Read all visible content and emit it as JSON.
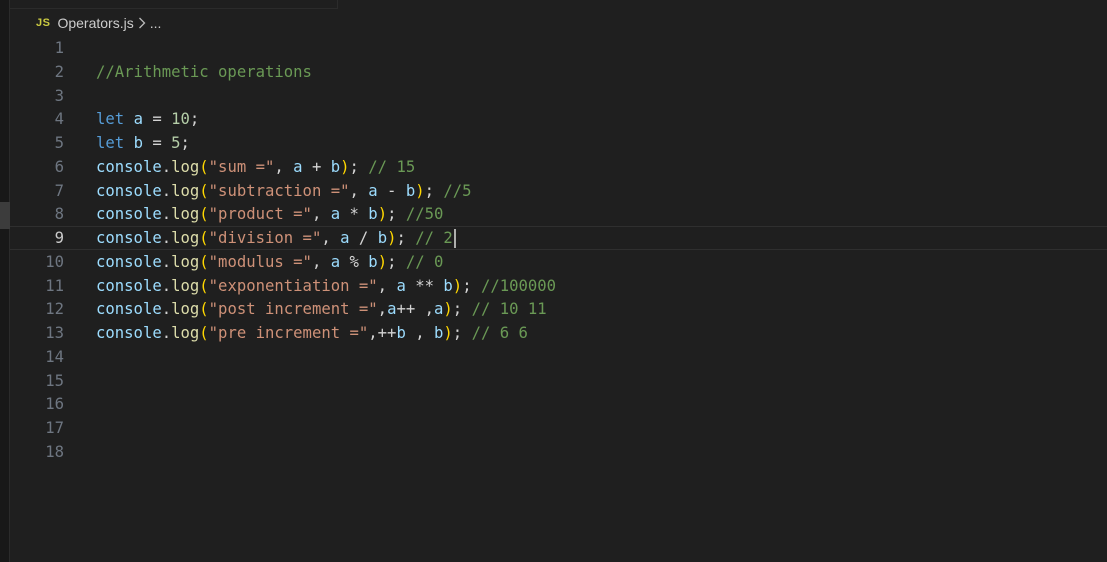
{
  "tab": {
    "filename": "Operators.js",
    "icon_text": "JS",
    "breadcrumb_more": "..."
  },
  "editor": {
    "current_line": 9,
    "lines": [
      {
        "n": "1",
        "tokens": []
      },
      {
        "n": "2",
        "tokens": [
          {
            "t": "//Arithmetic operations",
            "c": "cm"
          }
        ]
      },
      {
        "n": "3",
        "tokens": []
      },
      {
        "n": "4",
        "tokens": [
          {
            "t": "let",
            "c": "kw"
          },
          {
            "t": " ",
            "c": "pl"
          },
          {
            "t": "a",
            "c": "var"
          },
          {
            "t": " = ",
            "c": "op"
          },
          {
            "t": "10",
            "c": "num"
          },
          {
            "t": ";",
            "c": "pl"
          }
        ]
      },
      {
        "n": "5",
        "tokens": [
          {
            "t": "let",
            "c": "kw"
          },
          {
            "t": " ",
            "c": "pl"
          },
          {
            "t": "b",
            "c": "var"
          },
          {
            "t": " = ",
            "c": "op"
          },
          {
            "t": "5",
            "c": "num"
          },
          {
            "t": ";",
            "c": "pl"
          }
        ]
      },
      {
        "n": "6",
        "tokens": [
          {
            "t": "console",
            "c": "obj"
          },
          {
            "t": ".",
            "c": "pl"
          },
          {
            "t": "log",
            "c": "fn"
          },
          {
            "t": "(",
            "c": "paren"
          },
          {
            "t": "\"sum =\"",
            "c": "str"
          },
          {
            "t": ", ",
            "c": "pl"
          },
          {
            "t": "a",
            "c": "var"
          },
          {
            "t": " + ",
            "c": "op"
          },
          {
            "t": "b",
            "c": "var"
          },
          {
            "t": ")",
            "c": "paren"
          },
          {
            "t": "; ",
            "c": "pl"
          },
          {
            "t": "// 15",
            "c": "cm"
          }
        ]
      },
      {
        "n": "7",
        "tokens": [
          {
            "t": "console",
            "c": "obj"
          },
          {
            "t": ".",
            "c": "pl"
          },
          {
            "t": "log",
            "c": "fn"
          },
          {
            "t": "(",
            "c": "paren"
          },
          {
            "t": "\"subtraction =\"",
            "c": "str"
          },
          {
            "t": ", ",
            "c": "pl"
          },
          {
            "t": "a",
            "c": "var"
          },
          {
            "t": " - ",
            "c": "op"
          },
          {
            "t": "b",
            "c": "var"
          },
          {
            "t": ")",
            "c": "paren"
          },
          {
            "t": "; ",
            "c": "pl"
          },
          {
            "t": "//5",
            "c": "cm"
          }
        ]
      },
      {
        "n": "8",
        "tokens": [
          {
            "t": "console",
            "c": "obj"
          },
          {
            "t": ".",
            "c": "pl"
          },
          {
            "t": "log",
            "c": "fn"
          },
          {
            "t": "(",
            "c": "paren"
          },
          {
            "t": "\"product =\"",
            "c": "str"
          },
          {
            "t": ", ",
            "c": "pl"
          },
          {
            "t": "a",
            "c": "var"
          },
          {
            "t": " * ",
            "c": "op"
          },
          {
            "t": "b",
            "c": "var"
          },
          {
            "t": ")",
            "c": "paren"
          },
          {
            "t": "; ",
            "c": "pl"
          },
          {
            "t": "//50",
            "c": "cm"
          }
        ]
      },
      {
        "n": "9",
        "tokens": [
          {
            "t": "console",
            "c": "obj"
          },
          {
            "t": ".",
            "c": "pl"
          },
          {
            "t": "log",
            "c": "fn"
          },
          {
            "t": "(",
            "c": "paren"
          },
          {
            "t": "\"division =\"",
            "c": "str"
          },
          {
            "t": ", ",
            "c": "pl"
          },
          {
            "t": "a",
            "c": "var"
          },
          {
            "t": " / ",
            "c": "op"
          },
          {
            "t": "b",
            "c": "var"
          },
          {
            "t": ")",
            "c": "paren"
          },
          {
            "t": "; ",
            "c": "pl"
          },
          {
            "t": "// 2",
            "c": "cm"
          }
        ]
      },
      {
        "n": "10",
        "tokens": [
          {
            "t": "console",
            "c": "obj"
          },
          {
            "t": ".",
            "c": "pl"
          },
          {
            "t": "log",
            "c": "fn"
          },
          {
            "t": "(",
            "c": "paren"
          },
          {
            "t": "\"modulus =\"",
            "c": "str"
          },
          {
            "t": ", ",
            "c": "pl"
          },
          {
            "t": "a",
            "c": "var"
          },
          {
            "t": " % ",
            "c": "op"
          },
          {
            "t": "b",
            "c": "var"
          },
          {
            "t": ")",
            "c": "paren"
          },
          {
            "t": "; ",
            "c": "pl"
          },
          {
            "t": "// 0",
            "c": "cm"
          }
        ]
      },
      {
        "n": "11",
        "tokens": [
          {
            "t": "console",
            "c": "obj"
          },
          {
            "t": ".",
            "c": "pl"
          },
          {
            "t": "log",
            "c": "fn"
          },
          {
            "t": "(",
            "c": "paren"
          },
          {
            "t": "\"exponentiation =\"",
            "c": "str"
          },
          {
            "t": ", ",
            "c": "pl"
          },
          {
            "t": "a",
            "c": "var"
          },
          {
            "t": " ** ",
            "c": "op"
          },
          {
            "t": "b",
            "c": "var"
          },
          {
            "t": ")",
            "c": "paren"
          },
          {
            "t": "; ",
            "c": "pl"
          },
          {
            "t": "//100000",
            "c": "cm"
          }
        ]
      },
      {
        "n": "12",
        "tokens": [
          {
            "t": "console",
            "c": "obj"
          },
          {
            "t": ".",
            "c": "pl"
          },
          {
            "t": "log",
            "c": "fn"
          },
          {
            "t": "(",
            "c": "paren"
          },
          {
            "t": "\"post increment =\"",
            "c": "str"
          },
          {
            "t": ",",
            "c": "pl"
          },
          {
            "t": "a",
            "c": "var"
          },
          {
            "t": "++ ,",
            "c": "op"
          },
          {
            "t": "a",
            "c": "var"
          },
          {
            "t": ")",
            "c": "paren"
          },
          {
            "t": "; ",
            "c": "pl"
          },
          {
            "t": "// 10 11",
            "c": "cm"
          }
        ]
      },
      {
        "n": "13",
        "tokens": [
          {
            "t": "console",
            "c": "obj"
          },
          {
            "t": ".",
            "c": "pl"
          },
          {
            "t": "log",
            "c": "fn"
          },
          {
            "t": "(",
            "c": "paren"
          },
          {
            "t": "\"pre increment =\"",
            "c": "str"
          },
          {
            "t": ",++",
            "c": "op"
          },
          {
            "t": "b",
            "c": "var"
          },
          {
            "t": " , ",
            "c": "op"
          },
          {
            "t": "b",
            "c": "var"
          },
          {
            "t": ")",
            "c": "paren"
          },
          {
            "t": "; ",
            "c": "pl"
          },
          {
            "t": "// 6 6",
            "c": "cm"
          }
        ]
      },
      {
        "n": "14",
        "tokens": []
      },
      {
        "n": "15",
        "tokens": []
      },
      {
        "n": "16",
        "tokens": []
      },
      {
        "n": "17",
        "tokens": []
      },
      {
        "n": "18",
        "tokens": []
      }
    ]
  },
  "colors": {
    "background": "#1f1f1f",
    "keyword": "#569cd6",
    "variable": "#9cdcfe",
    "string": "#ce9178",
    "number": "#b5cea8",
    "function": "#dcdcaa",
    "bracket": "#ffd700",
    "comment": "#6a9955",
    "line_number": "#6e7681"
  }
}
